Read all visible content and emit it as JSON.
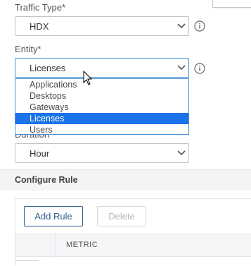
{
  "traffic_type": {
    "label": "Traffic Type*",
    "value": "HDX"
  },
  "entity": {
    "label": "Entity*",
    "value": "Licenses",
    "options": [
      "Applications",
      "Desktops",
      "Gateways",
      "Licenses",
      "Users"
    ],
    "selected_option": "Licenses"
  },
  "duration": {
    "label": "Duration",
    "value": "Hour"
  },
  "configure_rule": {
    "title": "Configure Rule",
    "add_rule_label": "Add Rule",
    "delete_label": "Delete",
    "columns": [
      "",
      "METRIC"
    ]
  },
  "icons": {
    "chevron": "chevron-down-icon",
    "info": "info-icon",
    "cursor": "mouse-pointer-icon"
  },
  "colors": {
    "accent_border": "#4a90d9",
    "selected_option_bg": "#1a73e8",
    "primary_button": "#2e5f8e"
  }
}
